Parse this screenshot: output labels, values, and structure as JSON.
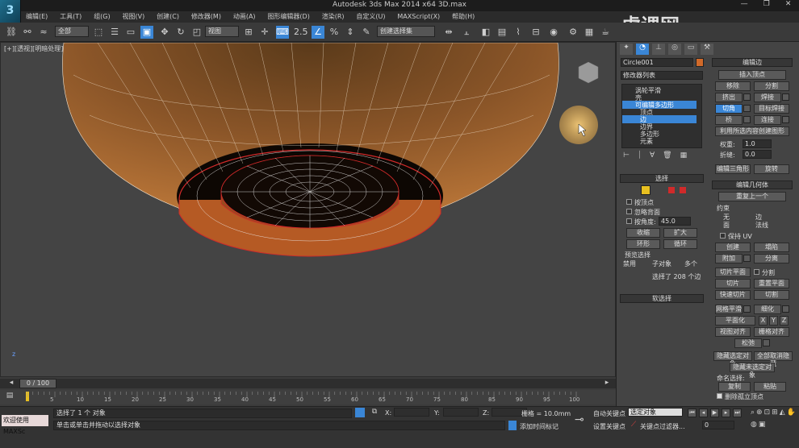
{
  "window": {
    "title": "Autodesk 3ds Max  2014 x64     3D.max",
    "controls": [
      "—",
      "❐",
      "✕"
    ],
    "watermark": "虎课网"
  },
  "menu": [
    "编辑(E)",
    "工具(T)",
    "组(G)",
    "视图(V)",
    "创建(C)",
    "修改器(M)",
    "动画(A)",
    "图形编辑器(D)",
    "渲染(R)",
    "自定义(U)",
    "MAXScript(X)",
    "帮助(H)"
  ],
  "toolbar": {
    "filter": "全部",
    "ref_coord": "视图",
    "snap_angle": "2.5",
    "selection_set": "创建选择集"
  },
  "viewport": {
    "label": "[+][透视][明暗处理]",
    "axis_label": "z"
  },
  "command_panel": {
    "object_name": "Circle001",
    "modifier_list": "修改器列表",
    "stack": [
      "涡轮平滑",
      "壳",
      "可编辑多边形",
      "顶点",
      "边",
      "边界",
      "多边形",
      "元素"
    ],
    "selection": {
      "title": "选择",
      "by_vertex": "按顶点",
      "ignore_backfacing": "忽略背面",
      "by_angle": "按角度:",
      "angle": "45.0",
      "shrink": "收缩",
      "grow": "扩大",
      "ring": "环形",
      "loop": "循环",
      "preview": "预览选择",
      "preview_opts": [
        "禁用",
        "子对象",
        "多个"
      ],
      "status": "选择了 208 个边"
    },
    "soft_selection": "软选择",
    "edit_edges": {
      "title": "编辑边",
      "insert_vertex": "插入顶点",
      "remove": "移除",
      "split": "分割",
      "extrude": "挤出",
      "weld": "焊接",
      "chamfer": "切角",
      "target_weld": "目标焊接",
      "bridge": "桥",
      "connect": "连接",
      "create_shape": "利用所选内容创建图形",
      "weight_label": "权重:",
      "weight": "1.0",
      "crease_label": "折缝:",
      "crease": "0.0",
      "edit_tri": "编辑三角形",
      "turn": "旋转"
    },
    "edit_geometry": {
      "title": "编辑几何体",
      "repeat_last": "重复上一个",
      "constraints": "约束",
      "c_opts": [
        "无",
        "边",
        "面",
        "法线"
      ],
      "preserve_uv": "保持 UV",
      "create": "创建",
      "collapse": "塌陷",
      "attach": "附加",
      "detach": "分离",
      "slice_plane": "切片平面",
      "split": "分割",
      "slice": "切片",
      "reset_plane": "重置平面",
      "quick_slice": "快速切片",
      "cut": "切割",
      "meshsmooth": "网格平滑",
      "tessellate": "细化",
      "make_planar": "平面化",
      "xyz": [
        "X",
        "Y",
        "Z"
      ],
      "view_align": "视图对齐",
      "grid_align": "栅格对齐",
      "relax": "松弛",
      "hide_sel": "隐藏选定对象",
      "unhide": "全部取消隐藏",
      "hide_unsel": "隐藏未选定对象",
      "named_sel": "命名选择:",
      "copy": "复制",
      "paste": "粘贴",
      "delete_iso": "删除孤立顶点"
    }
  },
  "timeline": {
    "frame": "0 / 100",
    "ticks": [
      "5",
      "10",
      "15",
      "20",
      "25",
      "30",
      "35",
      "40",
      "45",
      "50",
      "55",
      "60",
      "65",
      "70",
      "75",
      "80",
      "85",
      "90",
      "95",
      "100"
    ]
  },
  "status": {
    "maxscript": "欢迎使用 MAXSc",
    "line1": "选择了 1 个 对象",
    "line2": "单击或单击并拖动以选择对象",
    "x_label": "X:",
    "y_label": "Y:",
    "z_label": "Z:",
    "grid": "栅格 = 10.0mm",
    "auto_key": "自动关键点",
    "key_sel": "选定对象",
    "set_key": "设置关键点",
    "key_filter": "关键点过滤器...",
    "add_time_tag": "添加时间标记",
    "frame_field": "0"
  }
}
